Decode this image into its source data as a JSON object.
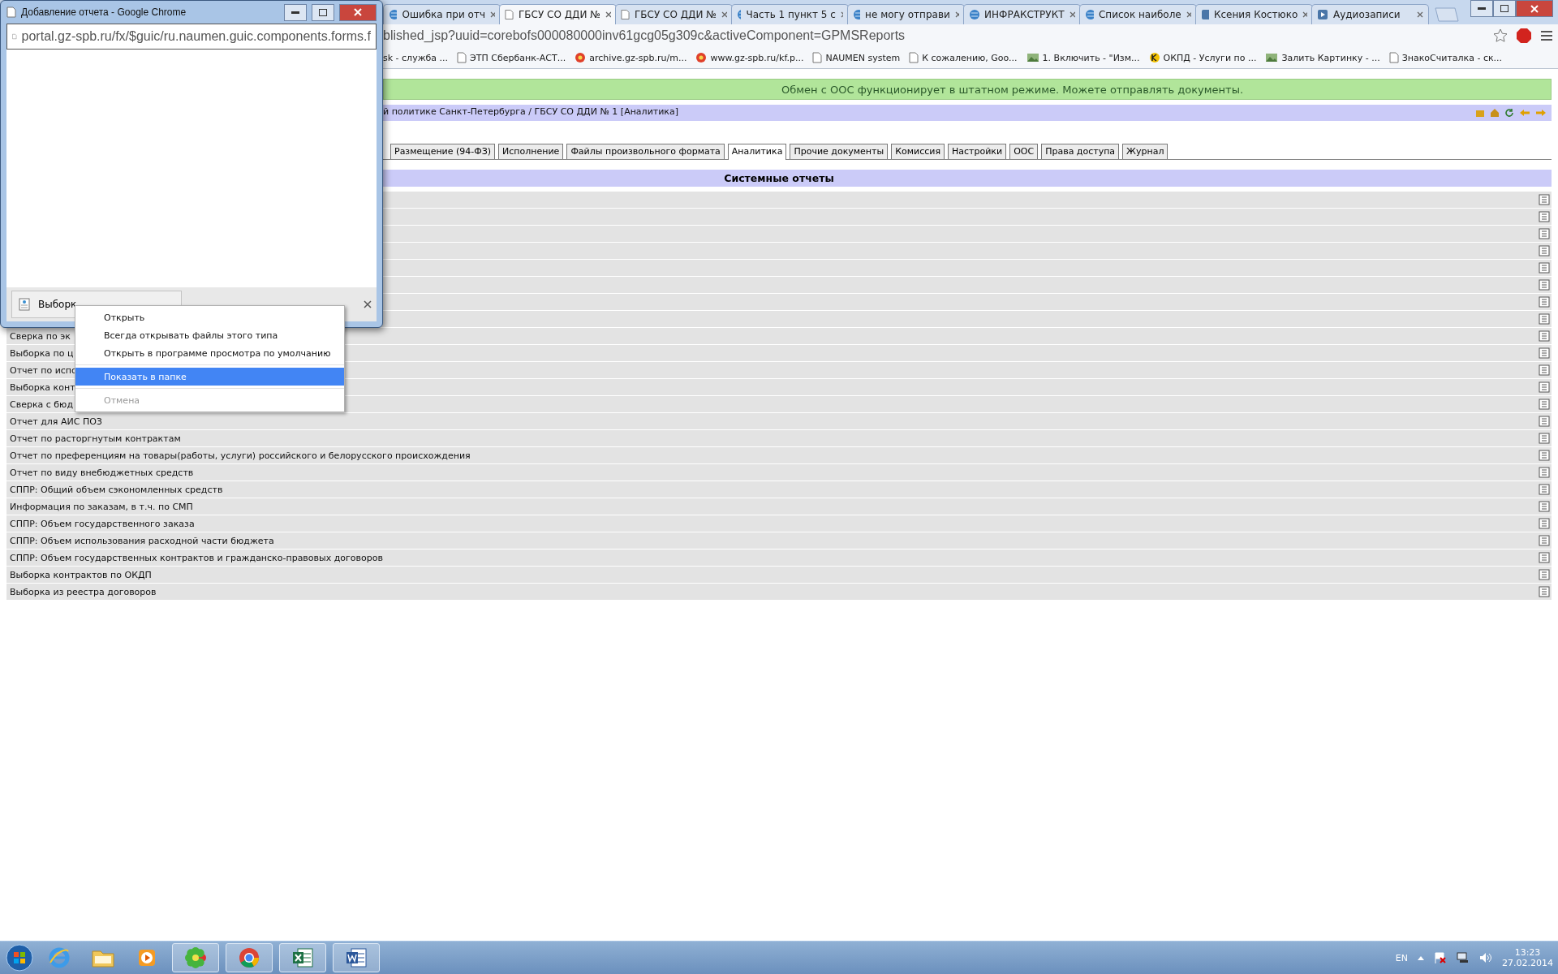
{
  "browser": {
    "tabs": [
      {
        "title": "Ошибка при отч",
        "selected": false,
        "kind": "globe"
      },
      {
        "title": "ГБСУ СО ДДИ №",
        "selected": true,
        "kind": "page"
      },
      {
        "title": "ГБСУ СО ДДИ №",
        "selected": false,
        "kind": "page"
      },
      {
        "title": "Часть 1 пункт 5 с",
        "selected": false,
        "kind": "globe"
      },
      {
        "title": "не могу отправи",
        "selected": false,
        "kind": "globe"
      },
      {
        "title": "ИНФРАКСТРУКТ",
        "selected": false,
        "kind": "globe"
      },
      {
        "title": "Список наиболе",
        "selected": false,
        "kind": "globe"
      },
      {
        "title": "Ксения Костюко",
        "selected": false,
        "kind": "social"
      },
      {
        "title": "Аудиозаписи",
        "selected": false,
        "kind": "audio"
      }
    ],
    "address": "blished_jsp?uuid=corebofs000080000inv61gcg05g309c&activeComponent=GPMSReports",
    "bookmarks": [
      {
        "label": "sk - служба ...",
        "kind": "none"
      },
      {
        "label": "ЭТП Сбербанк-АСТ...",
        "kind": "page"
      },
      {
        "label": "archive.gz-spb.ru/m...",
        "kind": "emblem"
      },
      {
        "label": "www.gz-spb.ru/kf.p...",
        "kind": "emblem"
      },
      {
        "label": "NAUMEN system",
        "kind": "page"
      },
      {
        "label": "К сожалению, Goo...",
        "kind": "page"
      },
      {
        "label": "1. Включить - \"Изм...",
        "kind": "photo"
      },
      {
        "label": "ОКПД - Услуги по ...",
        "kind": "letter"
      },
      {
        "label": "Залить Картинку - ...",
        "kind": "photo"
      },
      {
        "label": "ЗнакоСчиталка - ск...",
        "kind": "page"
      }
    ]
  },
  "page": {
    "notice": "Обмен с ООС функционирует в штатном режиме. Можете отправлять документы.",
    "breadcrumb": "й политике Санкт-Петербурга / ГБСУ СО ДДИ № 1 [Аналитика]",
    "tabs": [
      {
        "label": "Размещение (94-ФЗ)",
        "selected": false
      },
      {
        "label": "Исполнение",
        "selected": false
      },
      {
        "label": "Файлы произвольного формата",
        "selected": false
      },
      {
        "label": "Аналитика",
        "selected": true
      },
      {
        "label": "Прочие документы",
        "selected": false
      },
      {
        "label": "Комиссия",
        "selected": false
      },
      {
        "label": "Настройки",
        "selected": false
      },
      {
        "label": "ООС",
        "selected": false
      },
      {
        "label": "Права доступа",
        "selected": false
      },
      {
        "label": "Журнал",
        "selected": false
      }
    ],
    "section_title": "Системные отчеты",
    "rows": [
      {
        "kind": "covered"
      },
      {
        "kind": "covered"
      },
      {
        "kind": "covered"
      },
      {
        "kind": "covered"
      },
      {
        "kind": "covered"
      },
      {
        "kind": "covered"
      },
      {
        "kind": "covered"
      },
      {
        "kind": "covered"
      },
      {
        "kind": "report",
        "title": "Сверка по эк"
      },
      {
        "kind": "report",
        "title": "Выборка по ц"
      },
      {
        "kind": "report",
        "title": "Отчет по испо"
      },
      {
        "kind": "report",
        "title": "Выборка конт"
      },
      {
        "kind": "report",
        "title": "Сверка с бюд"
      },
      {
        "kind": "report",
        "title": "Отчет для АИС ПОЗ"
      },
      {
        "kind": "report",
        "title": "Отчет по расторгнутым контрактам"
      },
      {
        "kind": "report",
        "title": "Отчет по преференциям на товары(работы, услуги) российского и белорусского происхождения"
      },
      {
        "kind": "report",
        "title": "Отчет по виду внебюджетных средств"
      },
      {
        "kind": "report",
        "title": "СППР: Общий объем сэкономленных средств"
      },
      {
        "kind": "report",
        "title": "Информация по заказам, в т.ч. по СМП"
      },
      {
        "kind": "report",
        "title": "СППР: Объем государственного заказа"
      },
      {
        "kind": "report",
        "title": "СППР: Объем использования расходной части бюджета"
      },
      {
        "kind": "report",
        "title": "СППР: Объем государственных контрактов и гражданско-правовых договоров"
      },
      {
        "kind": "report",
        "title": "Выборка контрактов по ОКДП"
      },
      {
        "kind": "report",
        "title": "Выборка из реестра договоров"
      }
    ]
  },
  "popup": {
    "title": "Добавление отчета - Google Chrome",
    "url": "portal.gz-spb.ru/fx/$guic/ru.naumen.guic.components.forms.f",
    "download": "Выборк"
  },
  "context_menu": {
    "items": [
      {
        "kind": "item",
        "label": "Открыть",
        "selected": false,
        "disabled": false
      },
      {
        "kind": "item",
        "label": "Всегда открывать файлы этого типа",
        "selected": false,
        "disabled": false
      },
      {
        "kind": "item",
        "label": "Открыть в программе просмотра по умолчанию",
        "selected": false,
        "disabled": false
      },
      {
        "kind": "separator"
      },
      {
        "kind": "item",
        "label": "Показать в папке",
        "selected": true,
        "disabled": false
      },
      {
        "kind": "separator"
      },
      {
        "kind": "item",
        "label": "Отмена",
        "selected": false,
        "disabled": true
      }
    ]
  },
  "taskbar": {
    "apps": [
      {
        "kind": "ie",
        "running": false
      },
      {
        "kind": "folder",
        "running": false
      },
      {
        "kind": "media",
        "running": false
      },
      {
        "kind": "flower",
        "running": true
      },
      {
        "kind": "chrome",
        "running": true
      },
      {
        "kind": "sheet",
        "running": true
      },
      {
        "kind": "word",
        "running": true
      }
    ],
    "language": "EN",
    "time": "13:23",
    "date": "27.02.2014"
  }
}
